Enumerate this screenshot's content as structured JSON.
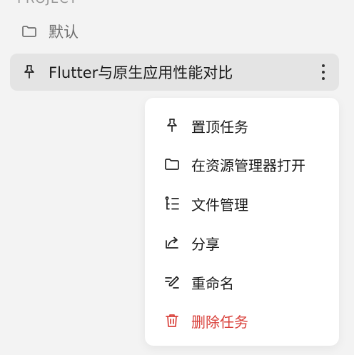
{
  "top_partial_text": "PROJECT",
  "folders": {
    "default": {
      "icon": "folder-icon",
      "label": "默认"
    },
    "selected": {
      "icon": "pin-icon",
      "label": "Flutter与原生应用性能对比",
      "more_icon": "more-vertical-icon"
    }
  },
  "context_menu": {
    "items": [
      {
        "icon": "pin-icon",
        "label": "置顶任务"
      },
      {
        "icon": "folder-icon",
        "label": "在资源管理器打开"
      },
      {
        "icon": "file-tree-icon",
        "label": "文件管理"
      },
      {
        "icon": "share-icon",
        "label": "分享"
      },
      {
        "icon": "rename-icon",
        "label": "重命名"
      },
      {
        "icon": "trash-icon",
        "label": "删除任务"
      }
    ],
    "danger_color": "#d9413b"
  }
}
